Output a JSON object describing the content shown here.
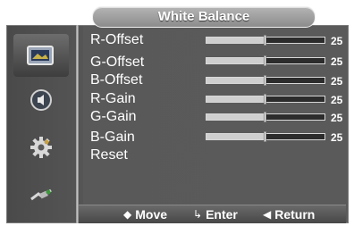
{
  "header": {
    "title": "White Balance"
  },
  "sidebar": {
    "items": [
      {
        "icon": "picture-icon",
        "active": true
      },
      {
        "icon": "sound-icon",
        "active": false
      },
      {
        "icon": "setup-gear-icon",
        "active": false
      },
      {
        "icon": "input-plug-icon",
        "active": false
      }
    ]
  },
  "menu": {
    "items": [
      {
        "label": "R-Offset",
        "value": "25",
        "level_fraction": 0.5
      },
      {
        "label": "G-Offset",
        "value": "25",
        "level_fraction": 0.5
      },
      {
        "label": "B-Offset",
        "value": "25",
        "level_fraction": 0.5
      },
      {
        "label": "R-Gain",
        "value": "25",
        "level_fraction": 0.5
      },
      {
        "label": "G-Gain",
        "value": "25",
        "level_fraction": 0.5
      },
      {
        "label": "B-Gain",
        "value": "25",
        "level_fraction": 0.5
      },
      {
        "label": "Reset"
      }
    ]
  },
  "footer": {
    "move": {
      "icon": "updown-arrows-icon",
      "label": "Move"
    },
    "enter": {
      "icon": "enter-icon",
      "label": "Enter"
    },
    "return": {
      "icon": "left-triangle-icon",
      "label": "Return"
    }
  }
}
